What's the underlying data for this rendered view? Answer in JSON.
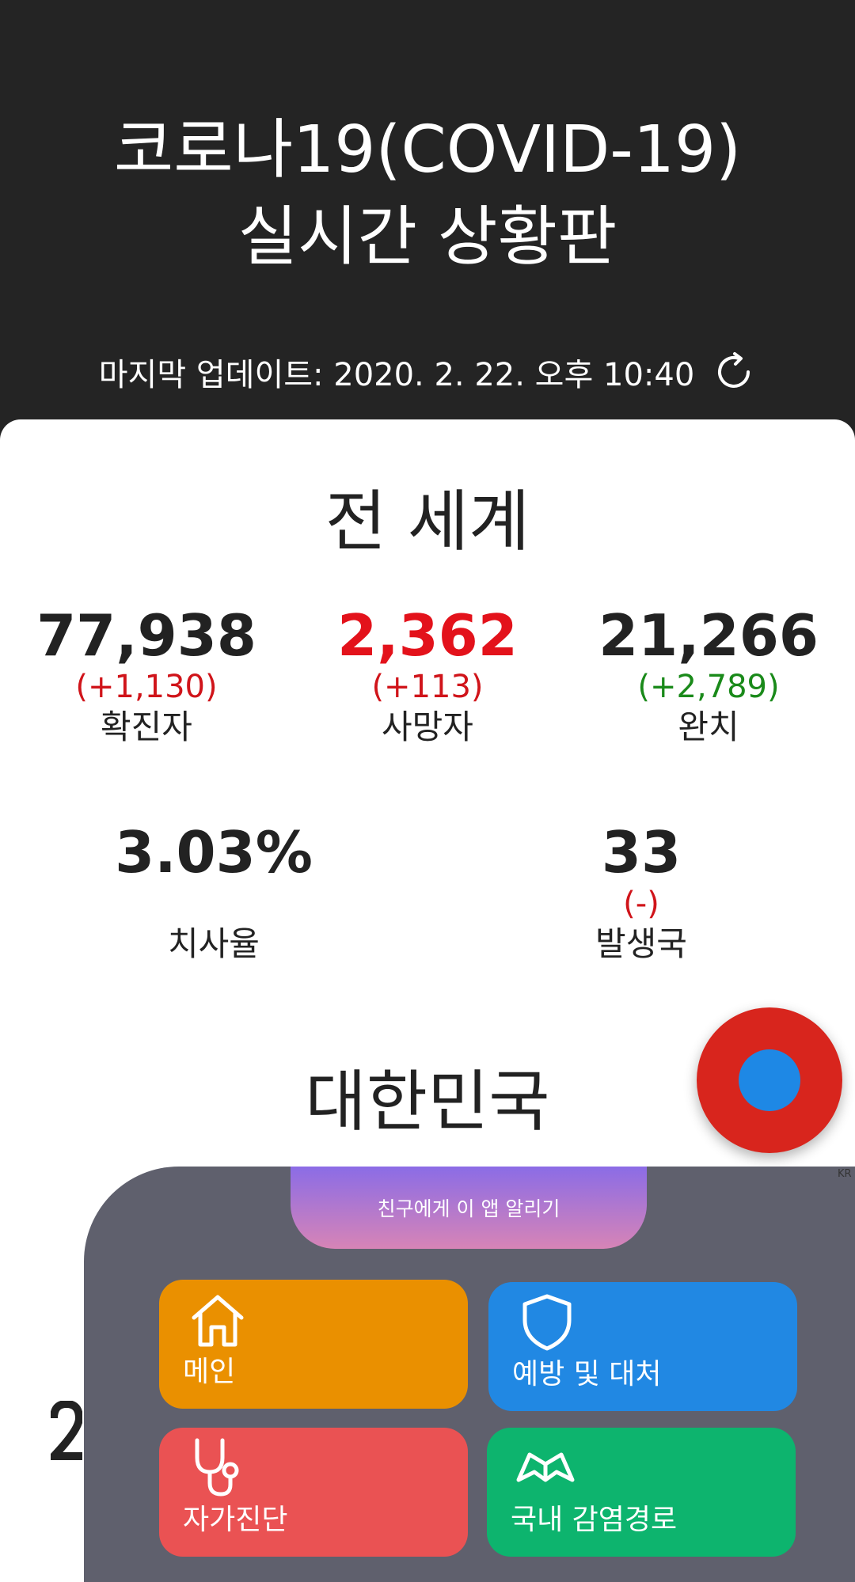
{
  "header": {
    "title_line1": "코로나19(COVID-19)",
    "title_line2": "실시간 상황판",
    "last_update": "마지막 업데이트: 2020. 2. 22. 오후 10:40"
  },
  "world": {
    "title": "전 세계",
    "confirmed": {
      "value": "77,938",
      "delta": "(+1,130)",
      "label": "확진자"
    },
    "deaths": {
      "value": "2,362",
      "delta": "(+113)",
      "label": "사망자"
    },
    "recovered": {
      "value": "21,266",
      "delta": "(+2,789)",
      "label": "완치"
    },
    "fatality_rate": {
      "value": "3.03%",
      "label": "치사율"
    },
    "countries": {
      "value": "33",
      "delta": "(-)",
      "label": "발생국"
    }
  },
  "korea": {
    "title": "대한민국"
  },
  "menu": {
    "share_label": "친구에게 이 앱 알리기",
    "corner_label": "KR",
    "tiles": [
      {
        "label": "메인",
        "icon": "home-icon",
        "color": "#ea9000"
      },
      {
        "label": "예방 및 대처",
        "icon": "shield-icon",
        "color": "#2188e3"
      },
      {
        "label": "자가진단",
        "icon": "stethoscope-icon",
        "color": "#ea5253"
      },
      {
        "label": "국내 감염경로",
        "icon": "map-icon",
        "color": "#0db46e"
      }
    ]
  },
  "colors": {
    "header_bg": "#242424",
    "death_red": "#e3121b",
    "delta_red": "#d0141a",
    "recovered_green": "#1a8a1a",
    "fab_red": "#d8251d",
    "fab_blue": "#1e88e5"
  }
}
